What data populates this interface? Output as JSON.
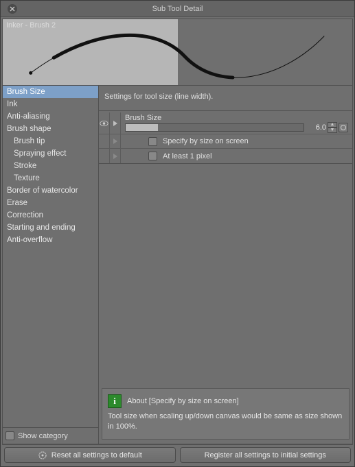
{
  "window": {
    "title": "Sub Tool Detail"
  },
  "preview": {
    "tool_name": "Inker - Brush 2"
  },
  "sidebar": {
    "items": [
      {
        "label": "Brush Size",
        "selected": true,
        "sub": false
      },
      {
        "label": "Ink",
        "selected": false,
        "sub": false
      },
      {
        "label": "Anti-aliasing",
        "selected": false,
        "sub": false
      },
      {
        "label": "Brush shape",
        "selected": false,
        "sub": false
      },
      {
        "label": "Brush tip",
        "selected": false,
        "sub": true
      },
      {
        "label": "Spraying effect",
        "selected": false,
        "sub": true
      },
      {
        "label": "Stroke",
        "selected": false,
        "sub": true
      },
      {
        "label": "Texture",
        "selected": false,
        "sub": true
      },
      {
        "label": "Border of watercolor",
        "selected": false,
        "sub": false
      },
      {
        "label": "Erase",
        "selected": false,
        "sub": false
      },
      {
        "label": "Correction",
        "selected": false,
        "sub": false
      },
      {
        "label": "Starting and ending",
        "selected": false,
        "sub": false
      },
      {
        "label": "Anti-overflow",
        "selected": false,
        "sub": false
      }
    ],
    "show_category_label": "Show category"
  },
  "settings": {
    "description": "Settings for tool size (line width).",
    "brush_size": {
      "label": "Brush Size",
      "value": "6.0",
      "fill_percent": 18
    },
    "specify_by_size": {
      "label": "Specify by size on screen",
      "checked": false
    },
    "at_least_1px": {
      "label": "At least 1 pixel",
      "checked": false
    }
  },
  "info": {
    "title": "About [Specify by size on screen]",
    "body": "Tool size when scaling up/down canvas would be same as size shown in 100%."
  },
  "buttons": {
    "reset": "Reset all settings to default",
    "register": "Register all settings to initial settings"
  }
}
